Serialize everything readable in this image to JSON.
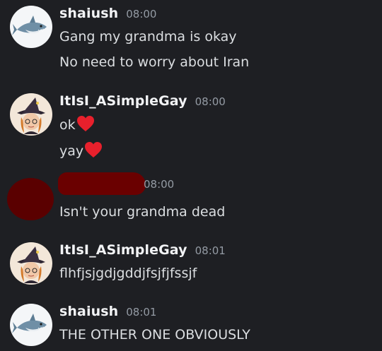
{
  "colors": {
    "background": "#1e1f23",
    "username": "#f2f3f5",
    "timestamp": "#949ba4",
    "message_text": "#dbdee1",
    "heart": "#e8202c",
    "redaction": "#6a0000"
  },
  "messages": [
    {
      "username": "shaiush",
      "timestamp": "08:00",
      "avatar_icon": "shark-avatar-icon",
      "lines": [
        "Gang my grandma is okay",
        "No need to worry about Iran"
      ]
    },
    {
      "username": "ItIsI_ASimpleGay",
      "timestamp": "08:00",
      "avatar_icon": "witch-avatar-icon",
      "lines": [
        "ok",
        "yay"
      ],
      "line_emoji": "heart-emoji-icon"
    },
    {
      "username": "",
      "timestamp": "08:00",
      "avatar_icon": "redacted-avatar",
      "lines": [
        "Isn't your grandma dead"
      ]
    },
    {
      "username": "ItIsI_ASimpleGay",
      "timestamp": "08:01",
      "avatar_icon": "witch-avatar-icon",
      "lines": [
        "flhfjsjgdjgddjfsjfjfssjf"
      ]
    },
    {
      "username": "shaiush",
      "timestamp": "08:01",
      "avatar_icon": "shark-avatar-icon",
      "lines": [
        "THE OTHER ONE OBVIOUSLY"
      ]
    }
  ]
}
